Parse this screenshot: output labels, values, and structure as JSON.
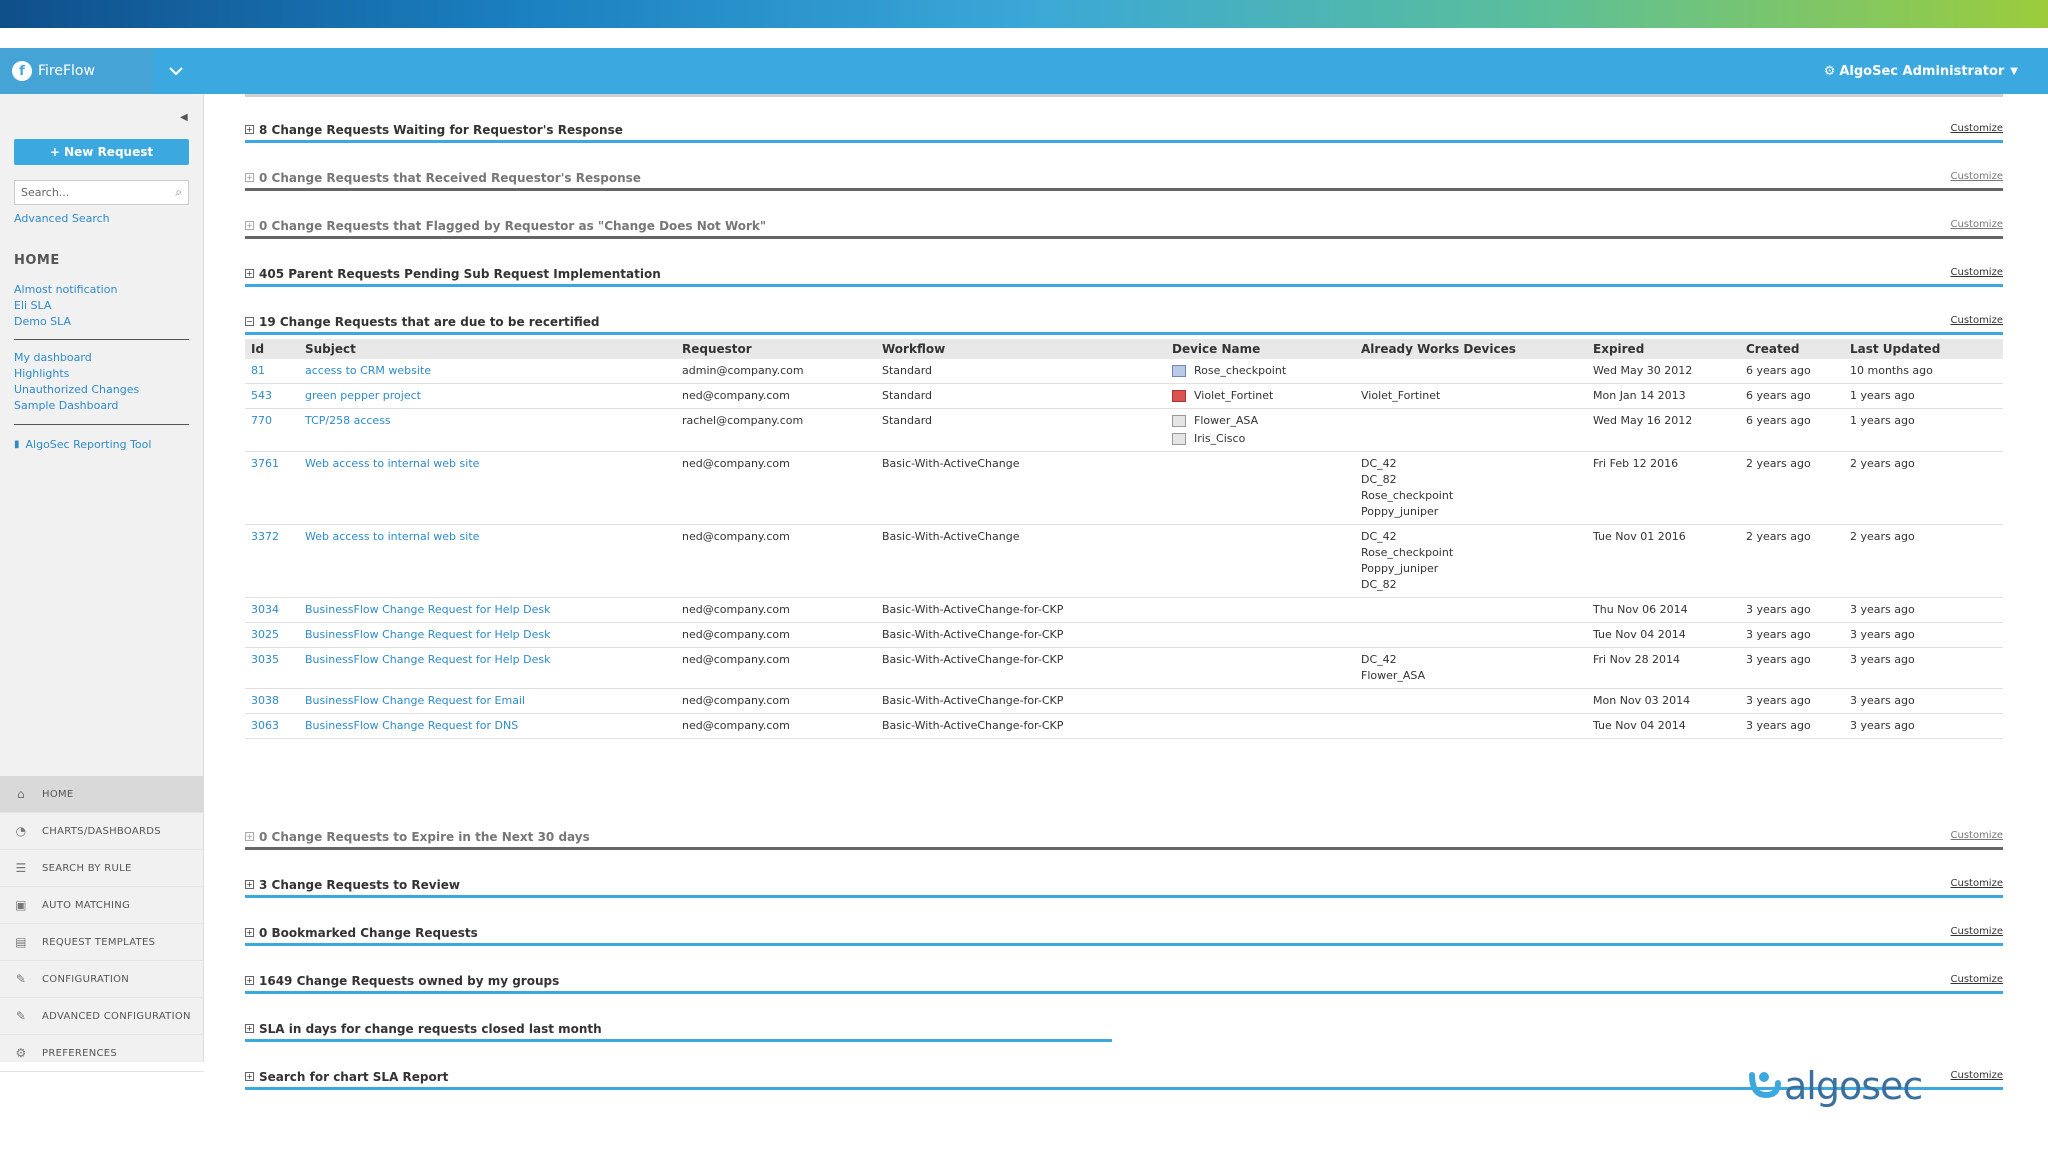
{
  "app": {
    "name": "FireFlow",
    "user_menu": "AlgoSec Administrator"
  },
  "sidebar": {
    "new_request": "+ New Request",
    "search_placeholder": "Search...",
    "advanced_search": "Advanced Search",
    "home_title": "HOME",
    "group1": [
      "Almost notification",
      "Eli SLA",
      "Demo SLA"
    ],
    "group2": [
      "My dashboard",
      "Highlights",
      "Unauthorized Changes",
      "Sample Dashboard"
    ],
    "reporting_tool": "AlgoSec Reporting Tool",
    "nav": [
      {
        "label": "HOME",
        "icon": "home-icon"
      },
      {
        "label": "CHARTS/DASHBOARDS",
        "icon": "chart-icon"
      },
      {
        "label": "SEARCH BY RULE",
        "icon": "search-rule-icon"
      },
      {
        "label": "AUTO MATCHING",
        "icon": "auto-matching-icon"
      },
      {
        "label": "REQUEST TEMPLATES",
        "icon": "template-icon"
      },
      {
        "label": "CONFIGURATION",
        "icon": "wrench-icon"
      },
      {
        "label": "ADVANCED CONFIGURATION",
        "icon": "advanced-wrench-icon"
      },
      {
        "label": "PREFERENCES",
        "icon": "gear-icon"
      }
    ]
  },
  "sections": {
    "s1": {
      "title": "8 Change Requests Waiting for Requestor's Response",
      "customize": "Customize"
    },
    "s2": {
      "title": "0 Change Requests that Received Requestor's Response",
      "customize": "Customize"
    },
    "s3": {
      "title": "0 Change Requests that Flagged by Requestor as \"Change Does Not Work\"",
      "customize": "Customize"
    },
    "s4": {
      "title": "405 Parent Requests Pending Sub Request Implementation",
      "customize": "Customize"
    },
    "s5": {
      "title": "19 Change Requests that are due to be recertified",
      "customize": "Customize"
    },
    "s6": {
      "title": "0 Change Requests to Expire in the Next 30 days",
      "customize": "Customize"
    },
    "s7": {
      "title": "3 Change Requests to Review",
      "customize": "Customize"
    },
    "s8": {
      "title": "0 Bookmarked Change Requests",
      "customize": "Customize"
    },
    "s9": {
      "title": "1649 Change Requests owned by my groups",
      "customize": "Customize"
    },
    "s10": {
      "title": "SLA in days for change requests closed last month"
    },
    "s11": {
      "title": "Search for chart SLA Report",
      "customize": "Customize"
    }
  },
  "table": {
    "headers": [
      "Id",
      "Subject",
      "Requestor",
      "Workflow",
      "Device Name",
      "Already Works Devices",
      "Expired",
      "Created",
      "Last Updated"
    ],
    "rows": [
      {
        "id": "81",
        "subject": "access to CRM website",
        "requestor": "admin@company.com",
        "workflow": "Standard",
        "devices": [
          "Rose_checkpoint"
        ],
        "works": [],
        "expired": "Wed May 30 2012",
        "created": "6 years ago",
        "updated": "10 months ago"
      },
      {
        "id": "543",
        "subject": "green pepper project",
        "requestor": "ned@company.com",
        "workflow": "Standard",
        "devices": [
          "Violet_Fortinet"
        ],
        "works": [
          "Violet_Fortinet"
        ],
        "expired": "Mon Jan 14 2013",
        "created": "6 years ago",
        "updated": "1 years ago"
      },
      {
        "id": "770",
        "subject": "TCP/258 access",
        "requestor": "rachel@company.com",
        "workflow": "Standard",
        "devices": [
          "Flower_ASA",
          "Iris_Cisco"
        ],
        "works": [],
        "expired": "Wed May 16 2012",
        "created": "6 years ago",
        "updated": "1 years ago"
      },
      {
        "id": "3761",
        "subject": "Web access to internal web site",
        "requestor": "ned@company.com",
        "workflow": "Basic-With-ActiveChange",
        "devices": [],
        "works": [
          "DC_42",
          "DC_82",
          "Rose_checkpoint",
          "Poppy_juniper"
        ],
        "expired": "Fri Feb 12 2016",
        "created": "2 years ago",
        "updated": "2 years ago"
      },
      {
        "id": "3372",
        "subject": "Web access to internal web site",
        "requestor": "ned@company.com",
        "workflow": "Basic-With-ActiveChange",
        "devices": [],
        "works": [
          "DC_42",
          "Rose_checkpoint",
          "Poppy_juniper",
          "DC_82"
        ],
        "expired": "Tue Nov 01 2016",
        "created": "2 years ago",
        "updated": "2 years ago"
      },
      {
        "id": "3034",
        "subject": "BusinessFlow Change Request for Help Desk",
        "requestor": "ned@company.com",
        "workflow": "Basic-With-ActiveChange-for-CKP",
        "devices": [],
        "works": [],
        "expired": "Thu Nov 06 2014",
        "created": "3 years ago",
        "updated": "3 years ago"
      },
      {
        "id": "3025",
        "subject": "BusinessFlow Change Request for Help Desk",
        "requestor": "ned@company.com",
        "workflow": "Basic-With-ActiveChange-for-CKP",
        "devices": [],
        "works": [],
        "expired": "Tue Nov 04 2014",
        "created": "3 years ago",
        "updated": "3 years ago"
      },
      {
        "id": "3035",
        "subject": "BusinessFlow Change Request for Help Desk",
        "requestor": "ned@company.com",
        "workflow": "Basic-With-ActiveChange-for-CKP",
        "devices": [],
        "works": [
          "DC_42",
          "Flower_ASA"
        ],
        "expired": "Fri Nov 28 2014",
        "created": "3 years ago",
        "updated": "3 years ago"
      },
      {
        "id": "3038",
        "subject": "BusinessFlow Change Request for Email",
        "requestor": "ned@company.com",
        "workflow": "Basic-With-ActiveChange-for-CKP",
        "devices": [],
        "works": [],
        "expired": "Mon Nov 03 2014",
        "created": "3 years ago",
        "updated": "3 years ago"
      },
      {
        "id": "3063",
        "subject": "BusinessFlow Change Request for DNS",
        "requestor": "ned@company.com",
        "workflow": "Basic-With-ActiveChange-for-CKP",
        "devices": [],
        "works": [],
        "expired": "Tue Nov 04 2014",
        "created": "3 years ago",
        "updated": "3 years ago"
      }
    ]
  },
  "footer_logo": "algosec",
  "colors": {
    "accent": "#3ba9e0",
    "link": "#2e8bc9"
  }
}
